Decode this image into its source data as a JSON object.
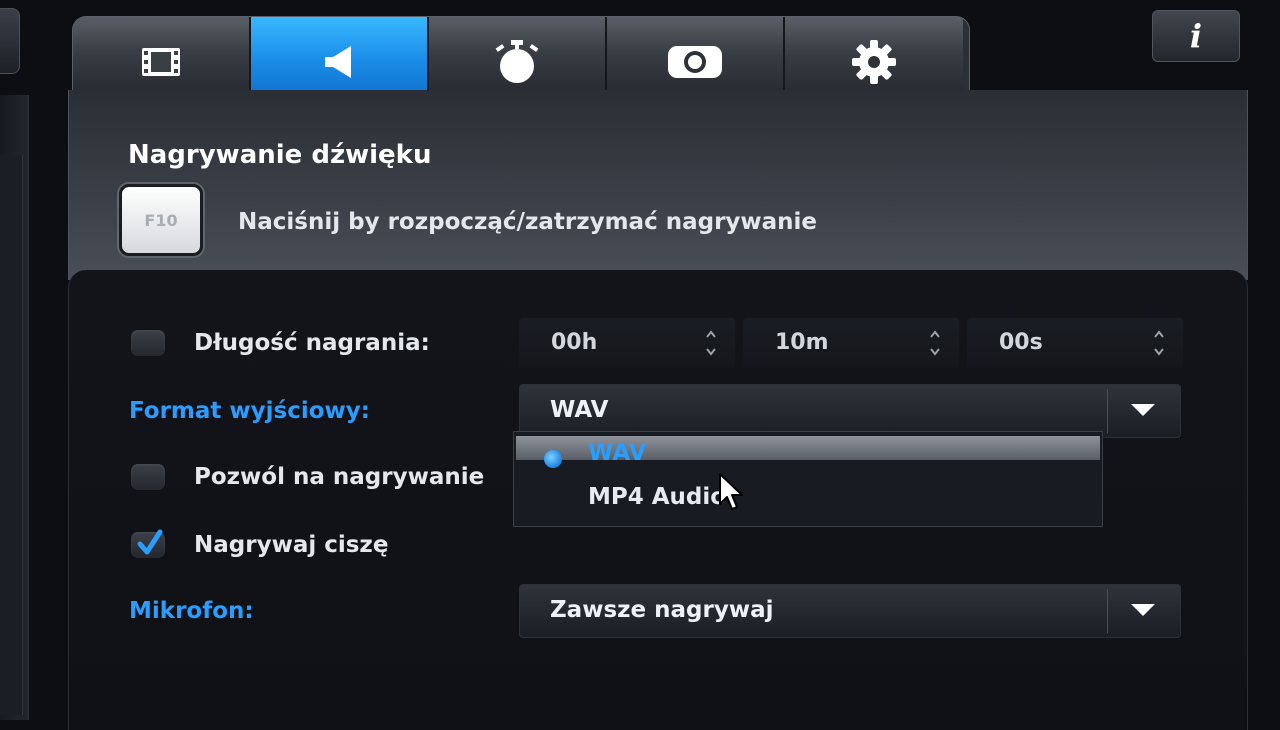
{
  "tabs": [
    {
      "icon": "film-icon",
      "active": false
    },
    {
      "icon": "speaker-icon",
      "active": true
    },
    {
      "icon": "stopwatch-icon",
      "active": false
    },
    {
      "icon": "camera-icon",
      "active": false
    },
    {
      "icon": "gear-icon",
      "active": false
    }
  ],
  "info_button": {
    "label": "i"
  },
  "section": {
    "title": "Nagrywanie dźwięku",
    "hotkey": "F10",
    "hotkey_description": "Naciśnij by rozpocząć/zatrzymać nagrywanie"
  },
  "options": {
    "duration": {
      "label": "Długość nagrania:",
      "enabled": false,
      "hours": "00h",
      "minutes": "10m",
      "seconds": "00s"
    },
    "output_format": {
      "label": "Format wyjściowy:",
      "value": "WAV",
      "dropdown_open": true,
      "options": [
        "WAV",
        "MP4 Audio"
      ],
      "selected_index": 0
    },
    "allow_recording": {
      "label": "Pozwól na nagrywanie",
      "checked": false
    },
    "record_silence": {
      "label": "Nagrywaj ciszę",
      "checked": true
    },
    "microphone": {
      "label": "Mikrofon:",
      "value": "Zawsze nagrywaj"
    }
  },
  "colors": {
    "accent_blue": "#2a9dff",
    "active_tab": "#1a8ee9",
    "panel_dark": "#121419"
  }
}
